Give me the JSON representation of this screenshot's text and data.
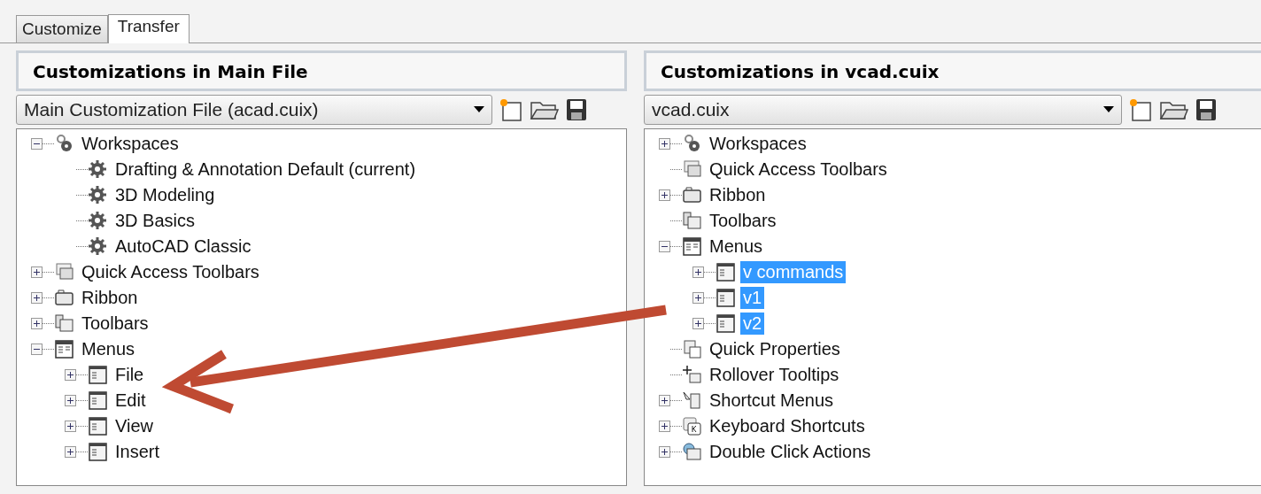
{
  "tabs": [
    {
      "label": "Customize",
      "selected": false
    },
    {
      "label": "Transfer",
      "selected": true
    }
  ],
  "panels": [
    {
      "title": "Customizations in Main File",
      "file": "Main Customization File (acad.cuix)",
      "tree": [
        {
          "label": "Workspaces",
          "kind": "workspaces",
          "expanded": true,
          "selected": false,
          "children": [
            {
              "label": "Drafting & Annotation Default (current)",
              "kind": "workspace",
              "selected": false
            },
            {
              "label": "3D Modeling",
              "kind": "workspace",
              "selected": false
            },
            {
              "label": "3D Basics",
              "kind": "workspace",
              "selected": false
            },
            {
              "label": "AutoCAD Classic",
              "kind": "workspace",
              "selected": false
            }
          ]
        },
        {
          "label": "Quick Access Toolbars",
          "kind": "quickaccess",
          "expanded": false,
          "selected": false
        },
        {
          "label": "Ribbon",
          "kind": "ribbon",
          "expanded": false,
          "selected": false
        },
        {
          "label": "Toolbars",
          "kind": "toolbars",
          "expanded": false,
          "selected": false
        },
        {
          "label": "Menus",
          "kind": "menus",
          "expanded": true,
          "selected": false,
          "children": [
            {
              "label": "File",
              "kind": "menu",
              "expanded": false,
              "selected": false
            },
            {
              "label": "Edit",
              "kind": "menu",
              "expanded": false,
              "selected": false
            },
            {
              "label": "View",
              "kind": "menu",
              "expanded": false,
              "selected": false
            },
            {
              "label": "Insert",
              "kind": "menu",
              "expanded": false,
              "selected": false
            }
          ]
        }
      ]
    },
    {
      "title": "Customizations in vcad.cuix",
      "file": "vcad.cuix",
      "tree": [
        {
          "label": "Workspaces",
          "kind": "workspaces",
          "expanded": false,
          "selected": false
        },
        {
          "label": "Quick Access Toolbars",
          "kind": "quickaccess",
          "selected": false
        },
        {
          "label": "Ribbon",
          "kind": "ribbon",
          "expanded": false,
          "selected": false
        },
        {
          "label": "Toolbars",
          "kind": "toolbars",
          "selected": false
        },
        {
          "label": "Menus",
          "kind": "menus",
          "expanded": true,
          "selected": false,
          "children": [
            {
              "label": "v commands",
              "kind": "menu",
              "expanded": false,
              "selected": true
            },
            {
              "label": "v1",
              "kind": "menu",
              "expanded": false,
              "selected": true
            },
            {
              "label": "v2",
              "kind": "menu",
              "expanded": false,
              "selected": true
            }
          ]
        },
        {
          "label": "Quick Properties",
          "kind": "quickprops",
          "selected": false
        },
        {
          "label": "Rollover Tooltips",
          "kind": "rollover",
          "selected": false
        },
        {
          "label": "Shortcut Menus",
          "kind": "shortcutmenus",
          "expanded": false,
          "selected": false
        },
        {
          "label": "Keyboard Shortcuts",
          "kind": "keyboard",
          "expanded": false,
          "selected": false
        },
        {
          "label": "Double Click Actions",
          "kind": "doubleclick",
          "expanded": false,
          "selected": false
        }
      ]
    }
  ]
}
